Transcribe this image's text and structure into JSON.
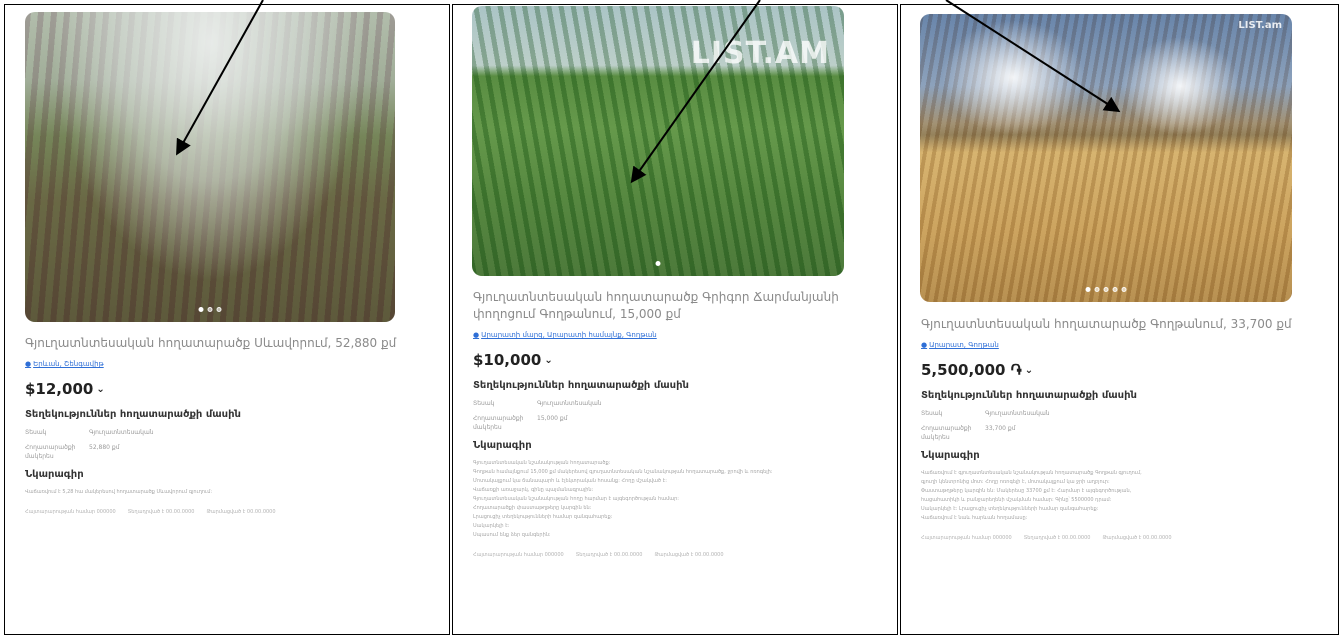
{
  "listings": [
    {
      "title": "Գյուղատնտեսական հողատարածք Սևավորում, 52,880 քմ",
      "location": "Երևան, Շենգավիթ",
      "price": "$12,000",
      "specs_heading": "Տեղեկություններ հողատարածքի մասին",
      "specs": [
        {
          "k": "Տեսակ",
          "v": "Գյուղատնտեսական"
        },
        {
          "k": "Հողատարածքի մակերես",
          "v": "52,880 քմ"
        }
      ],
      "desc_heading": "Նկարագիր",
      "desc_lines": [
        "Վաճառվում է 5,28 հա մակերեսով հողատարածք Սևավորում գյուղում:"
      ],
      "meta": [
        "Հայտարարության համար 000000",
        "Տեղադրված է 00.00.0000",
        "Թարմացված է 00.00.0000"
      ],
      "dots": 3,
      "watermark": ""
    },
    {
      "title": "Գյուղատնտեսական հողատարածք Գրիգոր Ճարմանյանի փողոցում Գողթանում, 15,000 քմ",
      "location": "Արարատի մարզ, Արարատի համայնք, Գողթան",
      "price": "$10,000",
      "specs_heading": "Տեղեկություններ հողատարածքի մասին",
      "specs": [
        {
          "k": "Տեսակ",
          "v": "Գյուղատնտեսական"
        },
        {
          "k": "Հողատարածքի մակերես",
          "v": "15,000 քմ"
        }
      ],
      "desc_heading": "Նկարագիր",
      "desc_lines": [
        "Գյուղատնտեսական նշանակության հողատարածք:",
        "Գողթան համայնքում 15,000 քմ մակերեսով գյուղատնտեսական նշանակության հողատարածք, ջրովի և ոռոգելի:",
        "Մոտակայքում կա ճանապարհ և էլեկտրական հոսանք: Հողը մշակված է:",
        "Վաճառքի առաջարկ, գինը պայմանագրային:",
        "Գյուղատնտեսական նշանակության հողը հարմար է այգեգործության համար:",
        "Հողատարածքի փաստաթղթերը կարգին են:",
        "Լրացուցիչ տեղեկությունների համար զանգահարեք:",
        "Սակարկելի է:",
        "Սպասում ենք ձեր զանգերին:"
      ],
      "meta": [
        "Հայտարարության համար 000000",
        "Տեղադրված է 00.00.0000",
        "Թարմացված է 00.00.0000"
      ],
      "dots": 1,
      "watermark": "LIST.AM"
    },
    {
      "title": "Գյուղատնտեսական հողատարածք Գողթանում, 33,700 քմ",
      "location": "Արարատ, Գողթան",
      "price": "5,500,000 ֏",
      "specs_heading": "Տեղեկություններ հողատարածքի մասին",
      "specs": [
        {
          "k": "Տեսակ",
          "v": "Գյուղատնտեսական"
        },
        {
          "k": "Հողատարածքի մակերես",
          "v": "33,700 քմ"
        }
      ],
      "desc_heading": "Նկարագիր",
      "desc_lines": [
        "Վաճառվում է գյուղատնտեսական նշանակության հողատարածք Գողթան գյուղում,",
        "գյուղի կենտրոնից մոտ: Հողը ոռոգելի է, մոտակայքում կա ջրի աղբյուր:",
        "Փաստաթղթերը կարգին են: Մակերեսը 33700 քմ է: Հարմար է այգեգործության,",
        "հացահատիկի և բանջարեղենի մշակման համար: Գինը՝ 5500000 դրամ:",
        "Սակարկելի է: Լրացուցիչ տեղեկությունների համար զանգահարեք:",
        "Վաճառվում է նաև հարևան հողամասը:"
      ],
      "meta": [
        "Հայտարարության համար 000000",
        "Տեղադրված է 00.00.0000",
        "Թարմացված է 00.00.0000"
      ],
      "dots": 5,
      "watermark": "LIST.am"
    }
  ],
  "colors": {
    "link": "#2f6fd6",
    "border": "#000000",
    "title_gray": "#8a8a8a"
  }
}
